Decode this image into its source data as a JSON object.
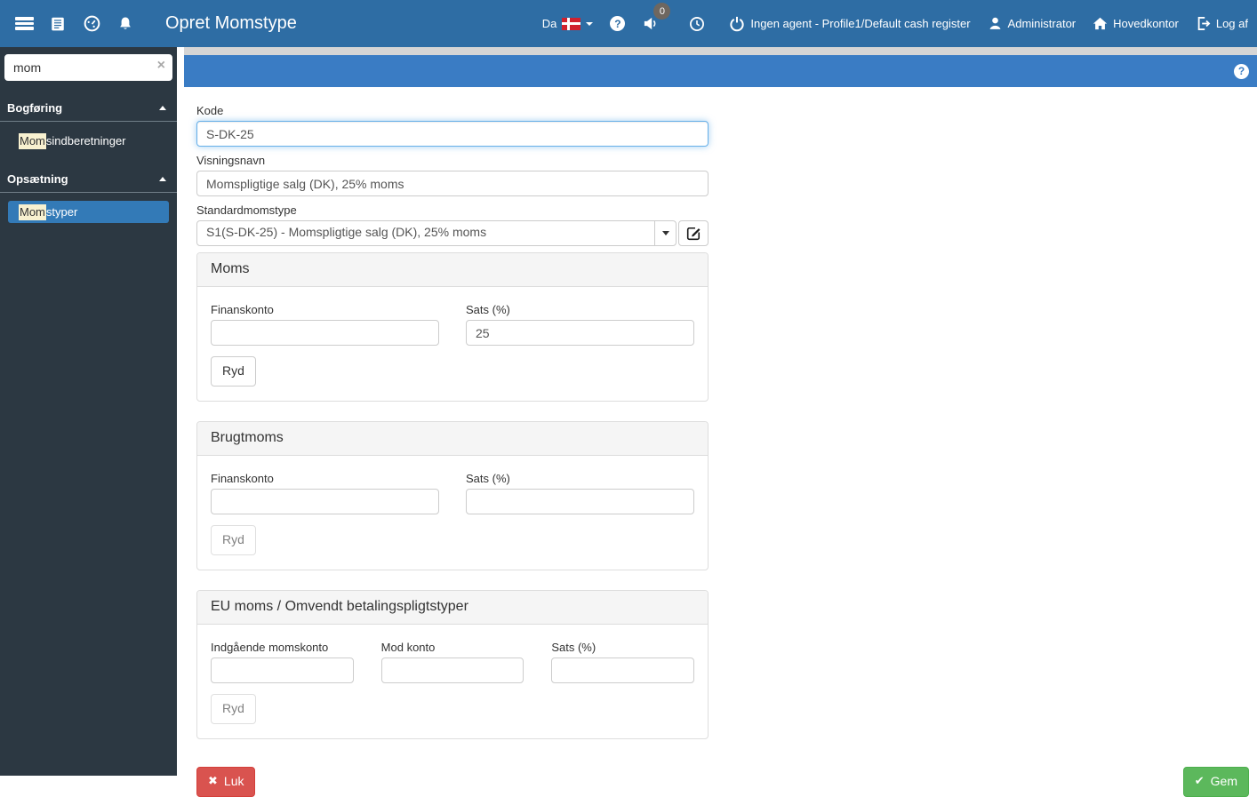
{
  "topbar": {
    "title": "Opret Momstype",
    "language": "Da",
    "badge_count": "0",
    "help_glyph": "?",
    "agent_text": "Ingen agent - Profile1/Default cash register",
    "user_label": "Administrator",
    "location_label": "Hovedkontor",
    "logout_label": "Log af"
  },
  "sidebar": {
    "search": {
      "value": "mom",
      "clear_glyph": "×"
    },
    "sections": [
      {
        "label": "Bogføring",
        "items": [
          {
            "highlight": "Mom",
            "rest": "sindberetninger",
            "selected": false
          }
        ]
      },
      {
        "label": "Opsætning",
        "items": [
          {
            "highlight": "Mom",
            "rest": "styper",
            "selected": true
          }
        ]
      }
    ]
  },
  "page": {
    "help_glyph": "?"
  },
  "form": {
    "kode": {
      "label": "Kode",
      "value": "S-DK-25"
    },
    "visningsnavn": {
      "label": "Visningsnavn",
      "value": "Momspligtige salg (DK), 25% moms"
    },
    "standardmomstype": {
      "label": "Standardmomstype",
      "value": "S1(S-DK-25) - Momspligtige salg (DK), 25% moms"
    },
    "panels": [
      {
        "title": "Moms",
        "fields": [
          {
            "label": "Finanskonto",
            "value": ""
          },
          {
            "label": "Sats (%)",
            "value": "25"
          }
        ],
        "clear_label": "Ryd",
        "clear_enabled": true
      },
      {
        "title": "Brugtmoms",
        "fields": [
          {
            "label": "Finanskonto",
            "value": ""
          },
          {
            "label": "Sats (%)",
            "value": ""
          }
        ],
        "clear_label": "Ryd",
        "clear_enabled": false
      },
      {
        "title": "EU moms / Omvendt betalingspligtstyper",
        "fields": [
          {
            "label": "Indgående momskonto",
            "value": ""
          },
          {
            "label": "Mod konto",
            "value": ""
          },
          {
            "label": "Sats (%)",
            "value": ""
          }
        ],
        "clear_label": "Ryd",
        "clear_enabled": false
      }
    ],
    "footer": {
      "close_label": "Luk",
      "close_glyph": "✖",
      "save_label": "Gem",
      "save_glyph": "✔"
    }
  },
  "colors": {
    "navbar_blue": "#2e6da4",
    "page_bar_blue": "#3a7cc4",
    "sidebar_dark": "#2c3842",
    "selected_blue": "#337ab7",
    "highlight_cream": "#f8f1d0",
    "danger_red": "#d9534f",
    "success_green": "#5cb85c",
    "focus_blue": "#66afe9"
  }
}
